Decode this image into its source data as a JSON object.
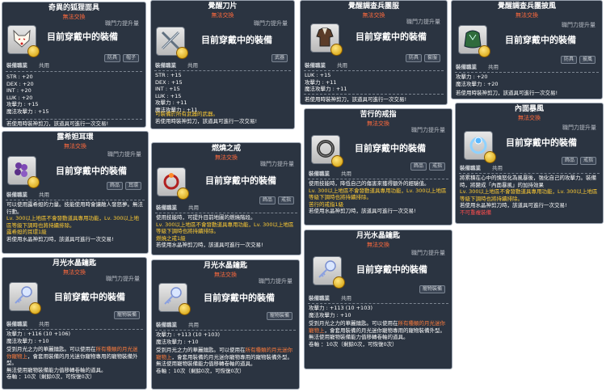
{
  "common": {
    "level": "職門力提升量",
    "untradeable": "無法交換",
    "equipped": "目前穿戴中的裝備",
    "job_label": "裝備職業",
    "job_value": "共用"
  },
  "cards": {
    "fox_mask": {
      "title": "奇異的狐狸面具",
      "tags": [
        "防具",
        "帽子"
      ],
      "stats": [
        "STR : +20",
        "DEX : +20",
        "INT : +20",
        "LUK : +20",
        "攻擊力 : +15",
        "魔法攻擊力 : +15"
      ],
      "desc": "若使用時裝神剪刀，該道具可進行一次交易!"
    },
    "blade": {
      "title": "覺醒刀片",
      "tags": [
        "武器"
      ],
      "stats": [
        "STR : +15",
        "DEX : +15",
        "INT : +15",
        "LUK : +15",
        "攻擊力 : +11",
        "魔法攻擊力 : +11"
      ],
      "desc1": "可裝備於所有武器的武器。",
      "desc2": "若使用時裝神剪刀，該道具可進行一次交易!"
    },
    "armor": {
      "title": "覺醒調查兵團服",
      "tags": [
        "防具",
        "套服"
      ],
      "stats": [
        "LUK : +15",
        "攻擊力 : +11",
        "魔法攻擊力 : +11"
      ],
      "desc": "若使用時裝神剪刀，該道具可進行一次交易!"
    },
    "cape": {
      "title": "覺醒調查兵團披風",
      "tags": [
        "防具",
        "披風"
      ],
      "stats": [
        "攻擊力 : +20",
        "魔法攻擊力 : +20"
      ],
      "desc": "若使用時裝神剪刀，該道具可進行一次交易!"
    },
    "earring": {
      "title": "露希妲耳環",
      "tags": [
        "飾品",
        "耳環"
      ],
      "desc1": "可以使用露希妲的力量。技能使用時會讓敵人發怒夢。無法行動。",
      "desc2": "Lv. 300以上地區不會發動道具專用功能，Lv. 300以上地區等級下調時也將持續排除。",
      "desc3": "露希妲的耳環1級",
      "desc4": "若使用水晶神剪刀時，該道具可進行一次交易!"
    },
    "burning_ring": {
      "title": "燃燒之戒",
      "tags": [
        "飾品",
        "戒指"
      ],
      "desc1": "使用技能時，可提升目前地圖的燃燒階段。",
      "desc2": "Lv. 300以上地區不會發動道具專用功能，Lv. 300以上地區等級下調時也將持續排除。",
      "desc3": "燃燒之戒1級",
      "desc4": "若使用水晶神剪刀時，該道具可進行一次交易!"
    },
    "suffer_ring": {
      "title": "苦行的戒指",
      "tags": [
        "飾品",
        "戒指"
      ],
      "desc1": "使用技能時，降低自己的傷害來獲得額外的經驗值。",
      "desc2": "Lv. 300以上地區不會發動道具專用功能，Lv. 300以上地區等級下調時也將持續排除。",
      "desc3": "苦行的戒指1級",
      "desc4": "若使用水晶神剪刀時，該道具可進行一次交易!"
    },
    "inner_storm": {
      "title": "內面暴風",
      "tags": [
        "飾品",
        "戒指"
      ],
      "desc1": "將累積在心中的憤怒化為風暴後，強化自己的攻擊力。裝備時，將變成「內面暴風」的加持效果",
      "desc2": "Lv. 300以上地區不會發動道具專用功能，Lv. 300以上地區等級下調時也將持續排除。",
      "desc3": "若使用水晶神剪刀時，該道具可進行一次交易!",
      "desc4": "不可重複裝備"
    },
    "moon_key1": {
      "title": "月光水晶鑰匙",
      "tags": [
        "寵物裝備"
      ],
      "stats": [
        "攻擊力 : +116 (10 +106)",
        "魔法攻擊力 : +10"
      ],
      "desc1": "受到月光之力的華麗鑰匙。可以使用在",
      "desc1b": "所有種類的月光迷你寵物上",
      "desc1c": "，會套用裝備的月光迷你寵物專用的寵物裝備外型。",
      "desc2": "無法使用寵物裝備能力值移轉卷軸的道具。",
      "desc3": "卷軸 ：10次（剩餘0次，可恢復0次）"
    },
    "moon_key2": {
      "title": "月光水晶鑰匙",
      "tags": [
        "寵物裝備"
      ],
      "stats": [
        "攻擊力 : +113 (10 +103)",
        "魔法攻擊力 : +10"
      ],
      "desc1": "受到月光之力的華麗鑰匙。可以使用在",
      "desc1b": "所有種類的月光迷你寵物上",
      "desc1c": "，會套用裝備的月光迷你寵物專用的寵物裝備外型。",
      "desc2": "無法使用寵物裝備能力值移轉卷軸的道具。",
      "desc3": "卷軸 ：10次（剩餘0次，可恢復0次）"
    },
    "moon_key3": {
      "title": "月光水晶鑰匙",
      "tags": [
        "寵物裝備"
      ],
      "stats": [
        "攻擊力 : +113 (10 +103)",
        "魔法攻擊力 : +10"
      ],
      "desc1": "受到月光之力的華麗鑰匙。可以使用在",
      "desc1b": "所有種類的月光迷你寵物上",
      "desc1c": "，會套用裝備的月光迷你寵物專用的寵物裝備外型。",
      "desc2": "無法使用寵物裝備能力值移轉卷軸的道具。",
      "desc3": "卷軸 ：10次（剩餘0次，可恢復0次）"
    }
  }
}
